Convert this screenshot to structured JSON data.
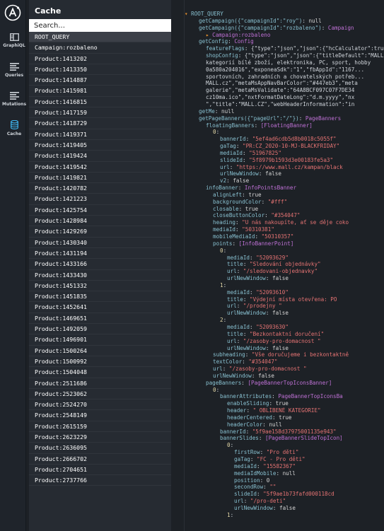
{
  "nav": {
    "items": [
      {
        "label": "GraphiQL",
        "icon": "graphiql-icon"
      },
      {
        "label": "Queries",
        "icon": "queries-icon"
      },
      {
        "label": "Mutations",
        "icon": "mutations-icon"
      },
      {
        "label": "Cache",
        "icon": "cache-icon"
      }
    ],
    "active": "Cache"
  },
  "cache": {
    "title": "Cache",
    "search_placeholder": "Search...",
    "selected": "ROOT_QUERY",
    "keys": [
      "ROOT_QUERY",
      "Campaign:rozbaleno",
      "Product:1413202",
      "Product:1413350",
      "Product:1414887",
      "Product:1415981",
      "Product:1416815",
      "Product:1417159",
      "Product:1418729",
      "Product:1419371",
      "Product:1419405",
      "Product:1419424",
      "Product:1419542",
      "Product:1419821",
      "Product:1420782",
      "Product:1421223",
      "Product:1425754",
      "Product:1428984",
      "Product:1429269",
      "Product:1430340",
      "Product:1431194",
      "Product:1433166",
      "Product:1433430",
      "Product:1451332",
      "Product:1451835",
      "Product:1452641",
      "Product:1469651",
      "Product:1492059",
      "Product:1496901",
      "Product:1500264",
      "Product:1500992",
      "Product:1504048",
      "Product:2511686",
      "Product:2523062",
      "Product:2524270",
      "Product:2548149",
      "Product:2615159",
      "Product:2623229",
      "Product:2636095",
      "Product:2666702",
      "Product:2704651",
      "Product:2737766"
    ]
  },
  "tree": {
    "lines": [
      {
        "indent": 0,
        "parts": [
          [
            "ar",
            "▾ "
          ],
          [
            "k",
            "ROOT_QUERY"
          ]
        ]
      },
      {
        "indent": 2,
        "parts": [
          [
            "k",
            "getCampaign({\"campaignId\":\"roy\")"
          ],
          [
            "p",
            ": "
          ],
          [
            "n",
            "null"
          ]
        ]
      },
      {
        "indent": 2,
        "parts": [
          [
            "k",
            "getCampaign({\"campaignId\":\"rozbaleno\")"
          ],
          [
            "p",
            ": "
          ],
          [
            "t",
            "Campaign"
          ]
        ]
      },
      {
        "indent": 3,
        "parts": [
          [
            "ar",
            "▸ "
          ],
          [
            "t",
            "Campaign:rozbaleno"
          ]
        ]
      },
      {
        "indent": 2,
        "parts": [
          [
            "k",
            "getConfig"
          ],
          [
            "p",
            ": "
          ],
          [
            "t",
            "Config"
          ]
        ]
      },
      {
        "indent": 3,
        "parts": [
          [
            "k",
            "featureFlags"
          ],
          [
            "p",
            ": {\"type\":\"json\",\"json\":{\"hcCalculator\":true"
          ]
        ]
      },
      {
        "indent": 3,
        "parts": [
          [
            "k",
            "shopConfig"
          ],
          [
            "p",
            ": {\"type\":\"json\",\"json\":{\"titleDefault\":\"MALL.CZ"
          ]
        ]
      },
      {
        "indent": 3,
        "parts": [
          [
            "p",
            "kategorií bílé zboží, elektronika, PC, sport, hobby"
          ]
        ]
      },
      {
        "indent": 3,
        "parts": [
          [
            "p",
            "0a580a204016\",\"exponeaSdk\":\"1\",\"fbAppId\":\"1167..."
          ]
        ]
      },
      {
        "indent": 3,
        "parts": [
          [
            "p",
            "sportovních, zahradních a chovatelských potřeb..."
          ]
        ]
      },
      {
        "indent": 3,
        "parts": [
          [
            "p",
            "MALL.cz\",\"metaMsAppNavBarColor\":\"#447eb3\",\"meta"
          ]
        ]
      },
      {
        "indent": 3,
        "parts": [
          [
            "p",
            "galerie\",\"metaMsValidate\":\"64A8BCF097C07F7DE34"
          ]
        ]
      },
      {
        "indent": 3,
        "parts": [
          [
            "p",
            "cz10ma.ico\",\"nxtFormatDateLong\":\"d.m.yyyy\",\"nx"
          ]
        ]
      },
      {
        "indent": 3,
        "parts": [
          [
            "p",
            "\",\"title\":\"MALL.CZ\",\"webHeaderInformation\":\"in"
          ]
        ]
      },
      {
        "indent": 2,
        "parts": [
          [
            "k",
            "getMe"
          ],
          [
            "p",
            ": "
          ],
          [
            "n",
            "null"
          ]
        ]
      },
      {
        "indent": 2,
        "parts": [
          [
            "k",
            "getPageBanners({\"pageUrl\":\"/\"})"
          ],
          [
            "p",
            ": "
          ],
          [
            "t",
            "PageBanners"
          ]
        ]
      },
      {
        "indent": 3,
        "parts": [
          [
            "k",
            "floatingBanners"
          ],
          [
            "p",
            ": "
          ],
          [
            "t",
            "[FloatingBanner]"
          ]
        ]
      },
      {
        "indent": 4,
        "parts": [
          [
            "i",
            "0"
          ],
          [
            "p",
            ":"
          ]
        ]
      },
      {
        "indent": 5,
        "parts": [
          [
            "k",
            "bannerId"
          ],
          [
            "p",
            ": "
          ],
          [
            "s",
            "\"5ef4ad6cdb5d8b0018c5055f\""
          ]
        ]
      },
      {
        "indent": 5,
        "parts": [
          [
            "k",
            "gaTag"
          ],
          [
            "p",
            ": "
          ],
          [
            "s",
            "\"PR:CZ_2020-10-MJ-BLACKFRIDAY\""
          ]
        ]
      },
      {
        "indent": 5,
        "parts": [
          [
            "k",
            "mediaId"
          ],
          [
            "p",
            ": "
          ],
          [
            "s",
            "\"51967825\""
          ]
        ]
      },
      {
        "indent": 5,
        "parts": [
          [
            "k",
            "slideId"
          ],
          [
            "p",
            ": "
          ],
          [
            "s",
            "\"5f8979b1593d3e00183fe5a3\""
          ]
        ]
      },
      {
        "indent": 5,
        "parts": [
          [
            "k",
            "url"
          ],
          [
            "p",
            ": "
          ],
          [
            "s",
            "\"https://www.mall.cz/kampan/black"
          ]
        ]
      },
      {
        "indent": 5,
        "parts": [
          [
            "k",
            "urlNewWindow"
          ],
          [
            "p",
            ": "
          ],
          [
            "n",
            "false"
          ]
        ]
      },
      {
        "indent": 5,
        "parts": [
          [
            "k",
            "v2"
          ],
          [
            "p",
            ": "
          ],
          [
            "n",
            "false"
          ]
        ]
      },
      {
        "indent": 3,
        "parts": [
          [
            "k",
            "infoBanner"
          ],
          [
            "p",
            ": "
          ],
          [
            "t",
            "InfoPointsBanner"
          ]
        ]
      },
      {
        "indent": 4,
        "parts": [
          [
            "k",
            "alignLeft"
          ],
          [
            "p",
            ": "
          ],
          [
            "n",
            "true"
          ]
        ]
      },
      {
        "indent": 4,
        "parts": [
          [
            "k",
            "backgroundColor"
          ],
          [
            "p",
            ": "
          ],
          [
            "s",
            "\"#fff\""
          ]
        ]
      },
      {
        "indent": 4,
        "parts": [
          [
            "k",
            "closable"
          ],
          [
            "p",
            ": "
          ],
          [
            "n",
            "true"
          ]
        ]
      },
      {
        "indent": 4,
        "parts": [
          [
            "k",
            "closeButtonColor"
          ],
          [
            "p",
            ": "
          ],
          [
            "s",
            "\"#354047\""
          ]
        ]
      },
      {
        "indent": 4,
        "parts": [
          [
            "k",
            "heading"
          ],
          [
            "p",
            ": "
          ],
          [
            "s",
            "\"U nás nakoupíte, ať se děje coko"
          ]
        ]
      },
      {
        "indent": 4,
        "parts": [
          [
            "k",
            "mediaId"
          ],
          [
            "p",
            ": "
          ],
          [
            "s",
            "\"50310381\""
          ]
        ]
      },
      {
        "indent": 4,
        "parts": [
          [
            "k",
            "mobileMediaId"
          ],
          [
            "p",
            ": "
          ],
          [
            "s",
            "\"50310357\""
          ]
        ]
      },
      {
        "indent": 4,
        "parts": [
          [
            "k",
            "points"
          ],
          [
            "p",
            ": "
          ],
          [
            "t",
            "[InfoBannerPoint]"
          ]
        ]
      },
      {
        "indent": 5,
        "parts": [
          [
            "i",
            "0"
          ],
          [
            "p",
            ":"
          ]
        ]
      },
      {
        "indent": 6,
        "parts": [
          [
            "k",
            "mediaId"
          ],
          [
            "p",
            ": "
          ],
          [
            "s",
            "\"52093629\""
          ]
        ]
      },
      {
        "indent": 6,
        "parts": [
          [
            "k",
            "title"
          ],
          [
            "p",
            ": "
          ],
          [
            "s",
            "\"Sledování objednávky\""
          ]
        ]
      },
      {
        "indent": 6,
        "parts": [
          [
            "k",
            "url"
          ],
          [
            "p",
            ": "
          ],
          [
            "s",
            "\"/sledovani-objednavky\""
          ]
        ]
      },
      {
        "indent": 6,
        "parts": [
          [
            "k",
            "urlNewWindow"
          ],
          [
            "p",
            ": "
          ],
          [
            "n",
            "false"
          ]
        ]
      },
      {
        "indent": 5,
        "parts": [
          [
            "i",
            "1"
          ],
          [
            "p",
            ":"
          ]
        ]
      },
      {
        "indent": 6,
        "parts": [
          [
            "k",
            "mediaId"
          ],
          [
            "p",
            ": "
          ],
          [
            "s",
            "\"52093610\""
          ]
        ]
      },
      {
        "indent": 6,
        "parts": [
          [
            "k",
            "title"
          ],
          [
            "p",
            ": "
          ],
          [
            "s",
            "\"Výdejní místa otevřena: PO"
          ]
        ]
      },
      {
        "indent": 6,
        "parts": [
          [
            "k",
            "url"
          ],
          [
            "p",
            ": "
          ],
          [
            "s",
            "\"/prodejny \""
          ]
        ]
      },
      {
        "indent": 6,
        "parts": [
          [
            "k",
            "urlNewWindow"
          ],
          [
            "p",
            ": "
          ],
          [
            "n",
            "false"
          ]
        ]
      },
      {
        "indent": 5,
        "parts": [
          [
            "i",
            "2"
          ],
          [
            "p",
            ":"
          ]
        ]
      },
      {
        "indent": 6,
        "parts": [
          [
            "k",
            "mediaId"
          ],
          [
            "p",
            ": "
          ],
          [
            "s",
            "\"52093630\""
          ]
        ]
      },
      {
        "indent": 6,
        "parts": [
          [
            "k",
            "title"
          ],
          [
            "p",
            ": "
          ],
          [
            "s",
            "\"Bezkontaktní doručení\""
          ]
        ]
      },
      {
        "indent": 6,
        "parts": [
          [
            "k",
            "url"
          ],
          [
            "p",
            ": "
          ],
          [
            "s",
            "\"/zasoby-pro-domacnost \""
          ]
        ]
      },
      {
        "indent": 6,
        "parts": [
          [
            "k",
            "urlNewWindow"
          ],
          [
            "p",
            ": "
          ],
          [
            "n",
            "false"
          ]
        ]
      },
      {
        "indent": 4,
        "parts": [
          [
            "k",
            "subheading"
          ],
          [
            "p",
            ": "
          ],
          [
            "s",
            "\"Vše doručujeme i bezkontaktně"
          ]
        ]
      },
      {
        "indent": 4,
        "parts": [
          [
            "k",
            "textColor"
          ],
          [
            "p",
            ": "
          ],
          [
            "s",
            "\"#354047\""
          ]
        ]
      },
      {
        "indent": 4,
        "parts": [
          [
            "k",
            "url"
          ],
          [
            "p",
            ": "
          ],
          [
            "s",
            "\"/zasoby-pro-domacnost \""
          ]
        ]
      },
      {
        "indent": 4,
        "parts": [
          [
            "k",
            "urlNewWindow"
          ],
          [
            "p",
            ": "
          ],
          [
            "n",
            "false"
          ]
        ]
      },
      {
        "indent": 3,
        "parts": [
          [
            "k",
            "pageBanners"
          ],
          [
            "p",
            ": "
          ],
          [
            "t",
            "[PageBannerTopIconsBanner]"
          ]
        ]
      },
      {
        "indent": 4,
        "parts": [
          [
            "i",
            "0"
          ],
          [
            "p",
            ":"
          ]
        ]
      },
      {
        "indent": 5,
        "parts": [
          [
            "k",
            "bannerAttributes"
          ],
          [
            "p",
            ": "
          ],
          [
            "t",
            "PageBannerTopIconsBa"
          ]
        ]
      },
      {
        "indent": 6,
        "parts": [
          [
            "k",
            "enableSliding"
          ],
          [
            "p",
            ": "
          ],
          [
            "n",
            "true"
          ]
        ]
      },
      {
        "indent": 6,
        "parts": [
          [
            "k",
            "header"
          ],
          [
            "p",
            ": "
          ],
          [
            "s",
            "\" OBLÍBENÉ KATEGORIE\""
          ]
        ]
      },
      {
        "indent": 6,
        "parts": [
          [
            "k",
            "headerCentered"
          ],
          [
            "p",
            ": "
          ],
          [
            "n",
            "true"
          ]
        ]
      },
      {
        "indent": 6,
        "parts": [
          [
            "k",
            "headerColor"
          ],
          [
            "p",
            ": "
          ],
          [
            "n",
            "null"
          ]
        ]
      },
      {
        "indent": 5,
        "parts": [
          [
            "k",
            "bannerId"
          ],
          [
            "p",
            ": "
          ],
          [
            "s",
            "\"5f9ae158d37975001135e943\""
          ]
        ]
      },
      {
        "indent": 5,
        "parts": [
          [
            "k",
            "bannerSlides"
          ],
          [
            "p",
            ": "
          ],
          [
            "t",
            "[PageBannerSlideTopIcon]"
          ]
        ]
      },
      {
        "indent": 6,
        "parts": [
          [
            "i",
            "0"
          ],
          [
            "p",
            ":"
          ]
        ]
      },
      {
        "indent": 7,
        "parts": [
          [
            "k",
            "firstRow"
          ],
          [
            "p",
            ": "
          ],
          [
            "s",
            "\"Pro děti\""
          ]
        ]
      },
      {
        "indent": 7,
        "parts": [
          [
            "k",
            "gaTag"
          ],
          [
            "p",
            ": "
          ],
          [
            "s",
            "\"FC - Pro děti\""
          ]
        ]
      },
      {
        "indent": 7,
        "parts": [
          [
            "k",
            "mediaId"
          ],
          [
            "p",
            ": "
          ],
          [
            "s",
            "\"15582367\""
          ]
        ]
      },
      {
        "indent": 7,
        "parts": [
          [
            "k",
            "mediaIdMobile"
          ],
          [
            "p",
            ": "
          ],
          [
            "n",
            "null"
          ]
        ]
      },
      {
        "indent": 7,
        "parts": [
          [
            "k",
            "position"
          ],
          [
            "p",
            ": "
          ],
          [
            "n",
            "0"
          ]
        ]
      },
      {
        "indent": 7,
        "parts": [
          [
            "k",
            "secondRow"
          ],
          [
            "p",
            ": "
          ],
          [
            "s",
            "\"\""
          ]
        ]
      },
      {
        "indent": 7,
        "parts": [
          [
            "k",
            "slideId"
          ],
          [
            "p",
            ": "
          ],
          [
            "s",
            "\"5f9ae1b73fafd000118cd"
          ]
        ]
      },
      {
        "indent": 7,
        "parts": [
          [
            "k",
            "url"
          ],
          [
            "p",
            ": "
          ],
          [
            "s",
            "\"/pro-deti\""
          ]
        ]
      },
      {
        "indent": 7,
        "parts": [
          [
            "k",
            "urlNewWindow"
          ],
          [
            "p",
            ": "
          ],
          [
            "n",
            "false"
          ]
        ]
      },
      {
        "indent": 6,
        "parts": [
          [
            "i",
            "1"
          ],
          [
            "p",
            ":"
          ]
        ]
      }
    ]
  }
}
